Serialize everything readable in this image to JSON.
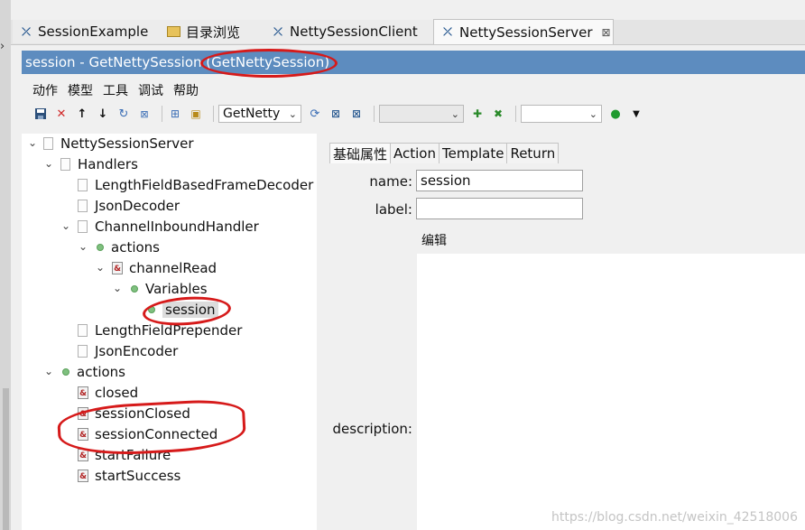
{
  "tabs": [
    {
      "label": "SessionExample",
      "icon": "netty-x-icon"
    },
    {
      "label": "目录浏览",
      "icon": "folder-icon"
    },
    {
      "label": "NettySessionClient",
      "icon": "netty-x-icon"
    },
    {
      "label": "NettySessionServer",
      "icon": "netty-x-icon",
      "active": true,
      "close": "⊠"
    }
  ],
  "title": "session - GetNettySession (GetNettySession)",
  "menu": [
    "动作",
    "模型",
    "工具",
    "调试",
    "帮助"
  ],
  "toolbar": {
    "combo1": "GetNetty",
    "combo2": "",
    "combo3": ""
  },
  "tree": {
    "root": "NettySessionServer",
    "handlers": "Handlers",
    "frameDecoder": "LengthFieldBasedFrameDecoder",
    "jsonDecoder": "JsonDecoder",
    "inbound": "ChannelInboundHandler",
    "actions1": "actions",
    "channelRead": "channelRead",
    "variables": "Variables",
    "session": "session",
    "prepender": "LengthFieldPrepender",
    "jsonEncoder": "JsonEncoder",
    "actions2": "actions",
    "closed": "closed",
    "sessionClosed": "sessionClosed",
    "sessionConnected": "sessionConnected",
    "startFailure": "startFailure",
    "startSuccess": "startSuccess"
  },
  "props": {
    "tabs": [
      "基础属性",
      "Action",
      "Template",
      "Return"
    ],
    "name_label": "name:",
    "name_value": "session",
    "label_label": "label:",
    "label_value": "",
    "edit_link": "编辑",
    "description_label": "description:"
  },
  "watermark": "https://blog.csdn.net/weixin_42518006",
  "colors": {
    "title_bar": "#5d8cbf",
    "annotation": "#d61a1a"
  }
}
